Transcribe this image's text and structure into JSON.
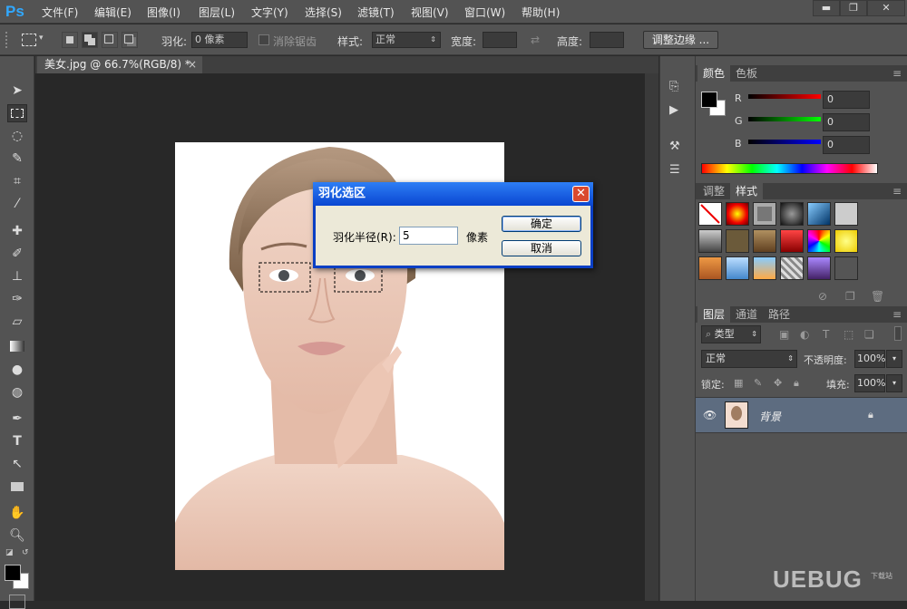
{
  "app": {
    "logo": "Ps"
  },
  "menu": [
    "文件(F)",
    "编辑(E)",
    "图像(I)",
    "图层(L)",
    "文字(Y)",
    "选择(S)",
    "滤镜(T)",
    "视图(V)",
    "窗口(W)",
    "帮助(H)"
  ],
  "window_controls": {
    "minimize": "▬",
    "restore": "❐",
    "close": "✕"
  },
  "options": {
    "feather_label": "羽化:",
    "feather_value": "0 像素",
    "antialias_label": "消除锯齿",
    "style_label": "样式:",
    "style_value": "正常",
    "width_label": "宽度:",
    "height_label": "高度:",
    "refine_edge": "调整边缘 ..."
  },
  "document": {
    "tab_title": "美女.jpg @ 66.7%(RGB/8) *",
    "tab_close": "×"
  },
  "color_panel": {
    "tabs": [
      "颜色",
      "色板"
    ],
    "channels": [
      {
        "label": "R",
        "value": "0",
        "color": "#d01010"
      },
      {
        "label": "G",
        "value": "0",
        "color": "#10c010"
      },
      {
        "label": "B",
        "value": "0",
        "color": "#1010d0"
      }
    ]
  },
  "styles_panel": {
    "tabs": [
      "调整",
      "样式"
    ]
  },
  "layers_panel": {
    "tabs": [
      "图层",
      "通道",
      "路径"
    ],
    "filter_kind": "类型",
    "blend_mode": "正常",
    "opacity_label": "不透明度:",
    "opacity_value": "100%",
    "lock_label": "锁定:",
    "fill_label": "填充:",
    "fill_value": "100%",
    "layers": [
      {
        "name": "背景",
        "visible": true,
        "locked": true
      }
    ]
  },
  "dialog": {
    "title": "羽化选区",
    "close": "✕",
    "radius_label": "羽化半径(R):",
    "radius_value": "5",
    "unit": "像素",
    "ok": "确定",
    "cancel": "取消"
  },
  "watermark": {
    "text": "UEBUG",
    "subtext": "下载站"
  }
}
